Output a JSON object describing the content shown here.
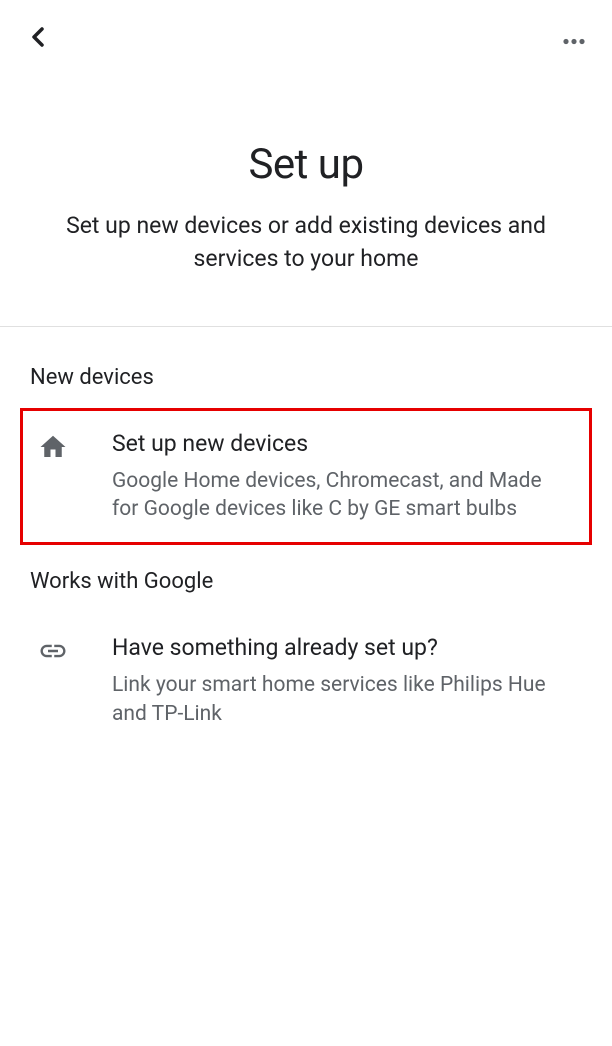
{
  "header": {
    "title": "Set up",
    "subtitle": "Set up new devices or add existing devices and services to your home"
  },
  "sections": {
    "new_devices": {
      "header": "New devices",
      "item": {
        "title": "Set up new devices",
        "desc": "Google Home devices, Chromecast, and Made for Google devices like C by GE smart bulbs"
      }
    },
    "works_with_google": {
      "header": "Works with Google",
      "item": {
        "title": "Have something already set up?",
        "desc": "Link your smart home services like Philips Hue and TP-Link"
      }
    }
  }
}
